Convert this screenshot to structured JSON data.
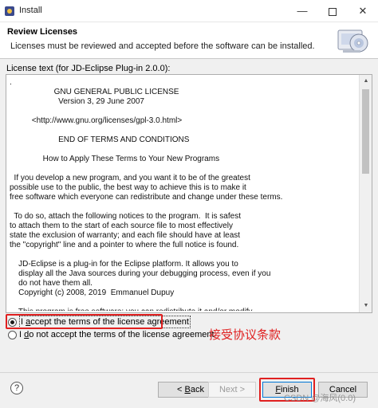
{
  "window": {
    "title": "Install",
    "minimize_glyph": "—",
    "close_glyph": "✕"
  },
  "header": {
    "title": "Review Licenses",
    "description": "Licenses must be reviewed and accepted before the software can be installed.",
    "icon": "install-cd-icon"
  },
  "license": {
    "label": "License text (for JD-Eclipse Plug-in 2.0.0):",
    "text_lines": [
      ".",
      "                    GNU GENERAL PUBLIC LICENSE",
      "                      Version 3, 29 June 2007",
      "",
      "          <http://www.gnu.org/licenses/gpl-3.0.html>",
      "",
      "                      END OF TERMS AND CONDITIONS",
      "",
      "               How to Apply These Terms to Your New Programs",
      "",
      "  If you develop a new program, and you want it to be of the greatest",
      "possible use to the public, the best way to achieve this is to make it",
      "free software which everyone can redistribute and change under these terms.",
      "",
      "  To do so, attach the following notices to the program.  It is safest",
      "to attach them to the start of each source file to most effectively",
      "state the exclusion of warranty; and each file should have at least",
      "the \"copyright\" line and a pointer to where the full notice is found.",
      "",
      "    JD-Eclipse is a plug-in for the Eclipse platform. It allows you to",
      "    display all the Java sources during your debugging process, even if you",
      "    do not have them all.",
      "    Copyright (c) 2008, 2019  Emmanuel Dupuy",
      "",
      "    This program is free software: you can redistribute it and/or modify"
    ],
    "scroll_up_glyph": "▲",
    "scroll_down_glyph": "▼"
  },
  "options": {
    "accept_prefix": "I ",
    "accept_mnemonic": "a",
    "accept_rest": "ccept the terms of the license agreement",
    "decline_prefix": "I ",
    "decline_mnemonic": "d",
    "decline_rest": "o not accept the terms of the license agreement",
    "selected": "accept"
  },
  "annotation": {
    "text": "接受协议条款",
    "color": "#e02020"
  },
  "footer": {
    "help_glyph": "?",
    "back_prefix": "< ",
    "back_mnemonic": "B",
    "back_rest": "ack",
    "next_label": "Next >",
    "finish_mnemonic": "F",
    "finish_rest": "inish",
    "cancel_label": "Cancel"
  },
  "watermark": "CSDN @海风(0.0)"
}
